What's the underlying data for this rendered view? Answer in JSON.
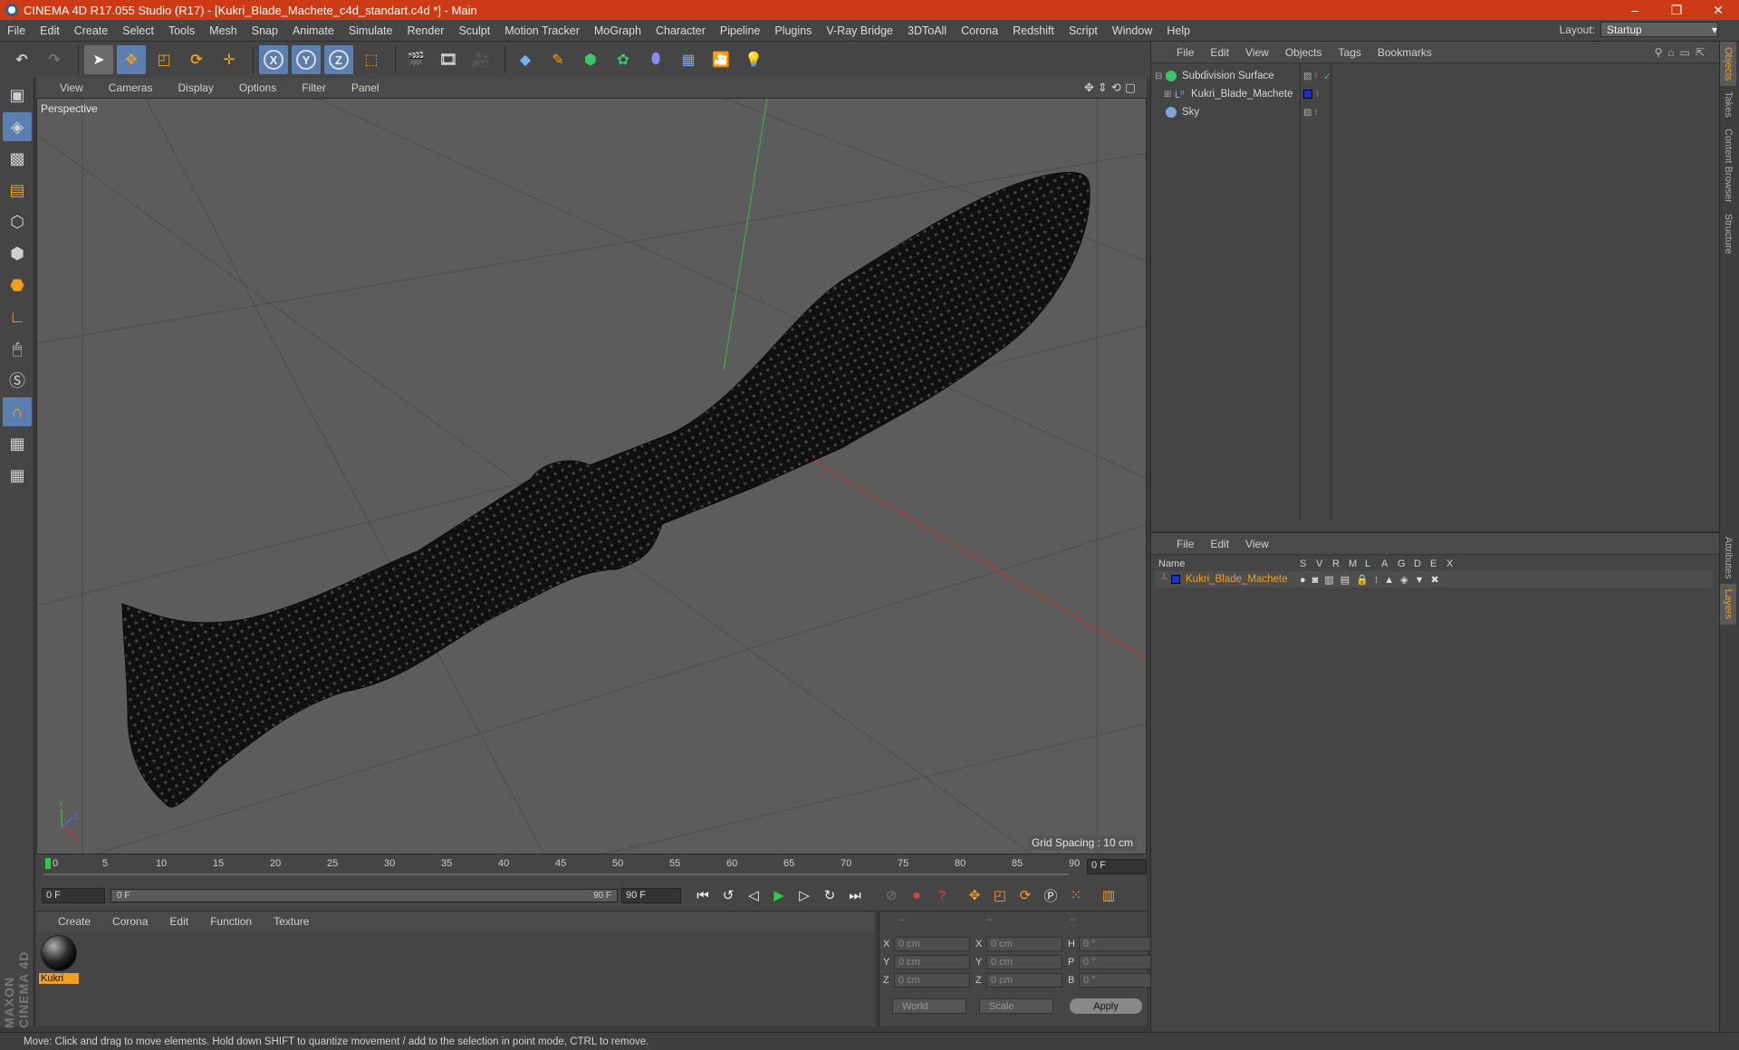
{
  "window": {
    "title": "CINEMA 4D R17.055 Studio (R17) - [Kukri_Blade_Machete_c4d_standart.c4d *] - Main",
    "controls": [
      "–",
      "❐",
      "✕"
    ]
  },
  "menubar": {
    "items": [
      "File",
      "Edit",
      "Create",
      "Select",
      "Tools",
      "Mesh",
      "Snap",
      "Animate",
      "Simulate",
      "Render",
      "Sculpt",
      "Motion Tracker",
      "MoGraph",
      "Character",
      "Pipeline",
      "Plugins",
      "V-Ray Bridge",
      "3DToAll",
      "Corona",
      "Redshift",
      "Script",
      "Window",
      "Help"
    ],
    "layout_label": "Layout:",
    "layout_value": "Startup"
  },
  "toolbar": {
    "axis_labels": [
      "X",
      "Y",
      "Z"
    ]
  },
  "viewport": {
    "menu": [
      "View",
      "Cameras",
      "Display",
      "Options",
      "Filter",
      "Panel"
    ],
    "camera_label": "Perspective",
    "grid_spacing": "Grid Spacing : 10 cm"
  },
  "timeline": {
    "ticks": [
      "0",
      "5",
      "10",
      "15",
      "20",
      "25",
      "30",
      "35",
      "40",
      "45",
      "50",
      "55",
      "60",
      "65",
      "70",
      "75",
      "80",
      "85",
      "90"
    ],
    "current_frame": "0 F",
    "start_frame": "0 F",
    "slider_start": "0 F",
    "slider_end": "90 F",
    "end_frame": "90 F"
  },
  "material_panel": {
    "menu": [
      "Create",
      "Corona",
      "Edit",
      "Function",
      "Texture"
    ],
    "material_name": "Kukri"
  },
  "coordinates": {
    "header": [
      "--",
      "--",
      "--"
    ],
    "rows": [
      {
        "a": "X",
        "v1": "0 cm",
        "b": "X",
        "v2": "0 cm",
        "c": "H",
        "v3": "0 °"
      },
      {
        "a": "Y",
        "v1": "0 cm",
        "b": "Y",
        "v2": "0 cm",
        "c": "P",
        "v3": "0 °"
      },
      {
        "a": "Z",
        "v1": "0 cm",
        "b": "Z",
        "v2": "0 cm",
        "c": "B",
        "v3": "0 °"
      }
    ],
    "space": "World",
    "mode": "Scale",
    "apply": "Apply"
  },
  "objects_panel": {
    "menu": [
      "File",
      "Edit",
      "View",
      "Objects",
      "Tags",
      "Bookmarks"
    ],
    "objects": [
      {
        "name": "Subdivision Surface",
        "icon_color": "#3ec26a"
      },
      {
        "name": "Kukri_Blade_Machete",
        "icon_color": "#8fb3e0"
      },
      {
        "name": "Sky",
        "icon_color": "#7fa6d6"
      }
    ]
  },
  "layers_panel": {
    "menu": [
      "File",
      "Edit",
      "View"
    ],
    "columns": [
      "Name",
      "S",
      "V",
      "R",
      "M",
      "L",
      "A",
      "G",
      "D",
      "E",
      "X"
    ],
    "layer_name": "Kukri_Blade_Machete",
    "layer_color": "#1a2fd0"
  },
  "right_tabs": [
    "Objects",
    "Takes",
    "Content Browser",
    "Structure",
    "Attributes",
    "Layers"
  ],
  "status": "Move: Click and drag to move elements. Hold down SHIFT to quantize movement / add to the selection in point mode, CTRL to remove.",
  "logo": "MAXON CINEMA 4D",
  "colors": {
    "titlebar": "#cc3a16",
    "accent_orange": "#f0a020",
    "selection_blue": "#5a7fb0"
  }
}
